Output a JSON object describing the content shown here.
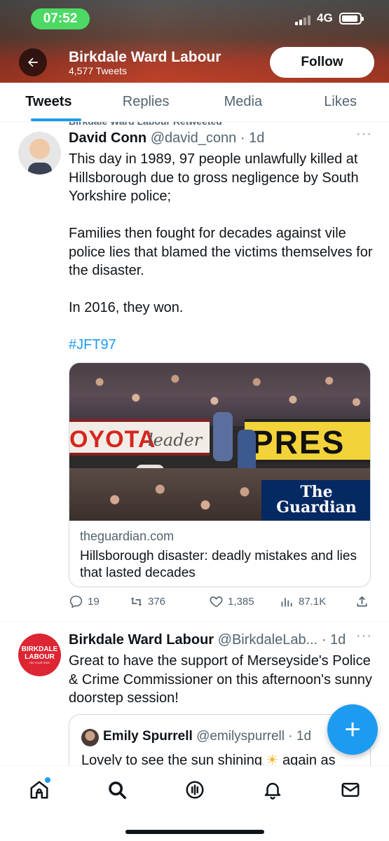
{
  "status_bar": {
    "time": "07:52",
    "network": "4G"
  },
  "header": {
    "name": "Birkdale Ward Labour",
    "tweet_count": "4,577 Tweets",
    "follow_label": "Follow"
  },
  "tabs": [
    {
      "label": "Tweets",
      "active": true
    },
    {
      "label": "Replies",
      "active": false
    },
    {
      "label": "Media",
      "active": false
    },
    {
      "label": "Likes",
      "active": false
    }
  ],
  "tweets": [
    {
      "retweeted_by": "Birkdale Ward Labour Retweeted",
      "name": "David Conn",
      "handle": "@david_conn",
      "time": "· 1d",
      "paragraphs": [
        "This day in 1989, 97 people unlawfully killed at Hillsborough due to gross negligence by South Yorkshire police;",
        "Families then fought for decades against vile police lies that blamed the victims themselves for the disaster.",
        "In 2016, they won."
      ],
      "hashtag": "#JFT97",
      "card": {
        "domain": "theguardian.com",
        "title": "Hillsborough disaster: deadly mistakes and lies that lasted decades",
        "image_sign_left": "OYOTA",
        "image_sign_script": "leader",
        "image_sign_right": "PRES",
        "logo_line1": "The",
        "logo_line2": "Guardian"
      },
      "stats": {
        "replies": "19",
        "retweets": "376",
        "likes": "1,385",
        "views": "87.1K"
      }
    },
    {
      "name": "Birkdale Ward Labour",
      "handle": "@BirkdaleLab...",
      "time": "· 1d",
      "avatar_text": [
        "BIRKDALE",
        "LABOUR",
        "ON YOUR SIDE"
      ],
      "text": "Great to have the support of Merseyside's Police & Crime Commissioner on this afternoon's sunny doorstep session!",
      "quote": {
        "name": "Emily Spurrell",
        "handle": "@emilyspurrell",
        "time": "· 1d",
        "text_before": "Lovely to see the sun shining",
        "text_after": "again as"
      }
    }
  ],
  "fab_label": "+",
  "colors": {
    "accent": "#1d9bf0",
    "labour_red": "#dd2533",
    "guardian_blue": "#052962"
  }
}
